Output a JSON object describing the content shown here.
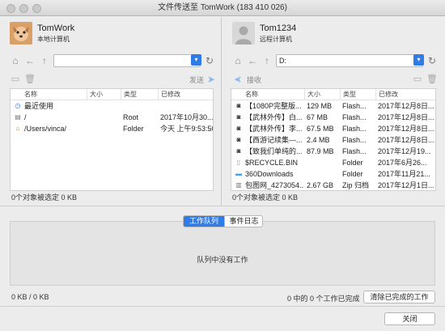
{
  "window": {
    "title": "文件传送至 TomWork (183 410 026)"
  },
  "left": {
    "user_name": "TomWork",
    "user_role": "本地计算机",
    "path": "",
    "send_label": "发送",
    "columns": [
      "名称",
      "大小",
      "类型",
      "已修改"
    ],
    "rows": [
      {
        "icon": "recent-icon",
        "name": "最近使用",
        "size": "",
        "type": "",
        "modified": ""
      },
      {
        "icon": "disk-icon",
        "name": "/",
        "size": "",
        "type": "Root",
        "modified": "2017年10月30..."
      },
      {
        "icon": "home-folder-icon",
        "name": "/Users/vinca/",
        "size": "",
        "type": "Folder",
        "modified": "今天 上午9:53:50"
      }
    ],
    "status": "0个对象被选定 0 KB"
  },
  "right": {
    "user_name": "Tom1234",
    "user_role": "远程计算机",
    "path": "D:",
    "receive_label": "接收",
    "columns": [
      "名称",
      "大小",
      "类型",
      "已修改"
    ],
    "rows": [
      {
        "icon": "flash-file-icon",
        "name": "【1080P完整版...",
        "size": "129 MB",
        "type": "Flash...",
        "modified": "2017年12月8日..."
      },
      {
        "icon": "flash-file-icon",
        "name": "【武林外传】白...",
        "size": "67 MB",
        "type": "Flash...",
        "modified": "2017年12月8日..."
      },
      {
        "icon": "flash-file-icon",
        "name": "【武林外传】李...",
        "size": "67.5 MB",
        "type": "Flash...",
        "modified": "2017年12月8日..."
      },
      {
        "icon": "flash-file-icon",
        "name": "【西游记续集—...",
        "size": "2.4 MB",
        "type": "Flash...",
        "modified": "2017年12月8日..."
      },
      {
        "icon": "flash-file-icon",
        "name": "【致我们单纯的...",
        "size": "87.9 MB",
        "type": "Flash...",
        "modified": "2017年12月19..."
      },
      {
        "icon": "blank-file-icon",
        "name": "$RECYCLE.BIN",
        "size": "",
        "type": "Folder",
        "modified": "2017年6月26..."
      },
      {
        "icon": "folder-icon",
        "name": "360Downloads",
        "size": "",
        "type": "Folder",
        "modified": "2017年11月21..."
      },
      {
        "icon": "zip-file-icon",
        "name": "包图网_4273054...",
        "size": "2.67 GB",
        "type": "Zip 归档",
        "modified": "2017年12月1日..."
      }
    ],
    "status": "0个对象被选定 0 KB"
  },
  "tabs": [
    {
      "label": "工作队列",
      "active": true
    },
    {
      "label": "事件日志",
      "active": false
    }
  ],
  "queue": {
    "empty_message": "队列中没有工作",
    "transfer_total": "0 KB / 0 KB",
    "completed_summary": "0 中的 0 个工作已完成",
    "clear_button": "清除已完成的工作"
  },
  "footer": {
    "close_button": "关闭"
  },
  "colors": {
    "accent": "#2f7be8",
    "panel_bg": "#ececec",
    "table_bg": "#ffffff"
  }
}
